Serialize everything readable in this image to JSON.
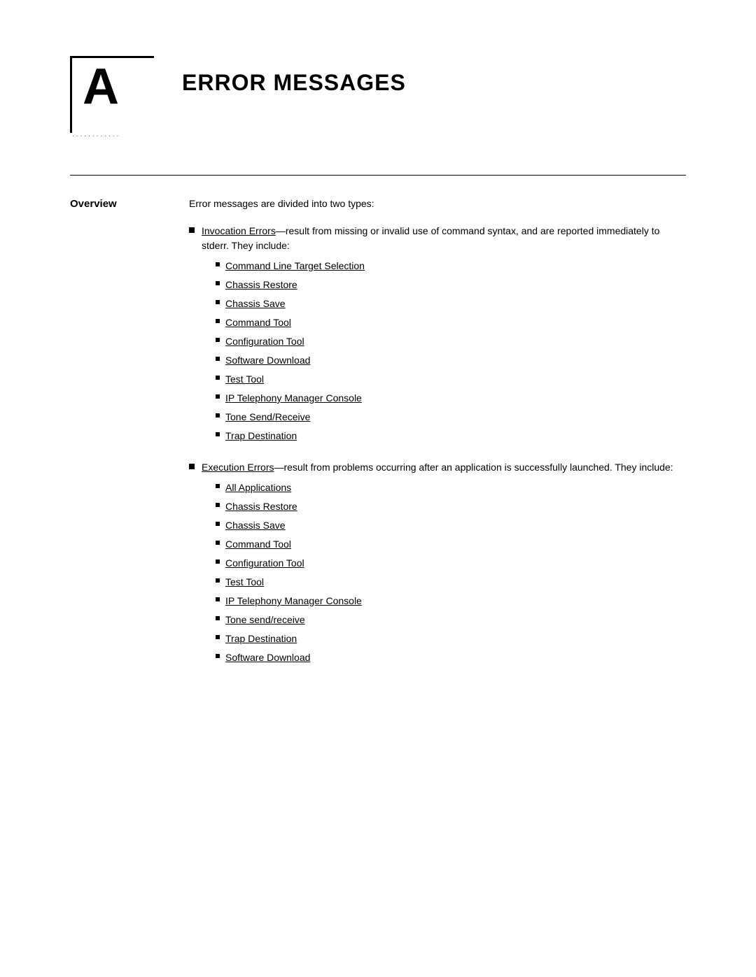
{
  "chapter": {
    "letter": "A",
    "dots": "............",
    "title_prefix": "Error",
    "title_suffix": "Messages"
  },
  "overview": {
    "label": "Overview",
    "intro": "Error messages are divided into two types:",
    "invocation": {
      "link_text": "Invocation Errors",
      "description": "—result from missing or invalid use of command syntax, and are reported immediately to stderr. They include:",
      "items": [
        "Command Line Target Selection",
        "Chassis Restore",
        "Chassis Save",
        "Command Tool",
        "Configuration Tool",
        "Software Download",
        "Test Tool",
        "IP Telephony Manager Console",
        "Tone Send/Receive",
        "Trap Destination"
      ]
    },
    "execution": {
      "link_text": "Execution Errors",
      "description": "—result from problems occurring after an application is successfully launched. They include:",
      "items": [
        "All Applications",
        "Chassis Restore",
        "Chassis Save",
        "Command Tool",
        "Configuration Tool",
        "Test Tool",
        "IP Telephony Manager Console",
        "Tone send/receive",
        "Trap Destination",
        "Software Download"
      ]
    }
  }
}
